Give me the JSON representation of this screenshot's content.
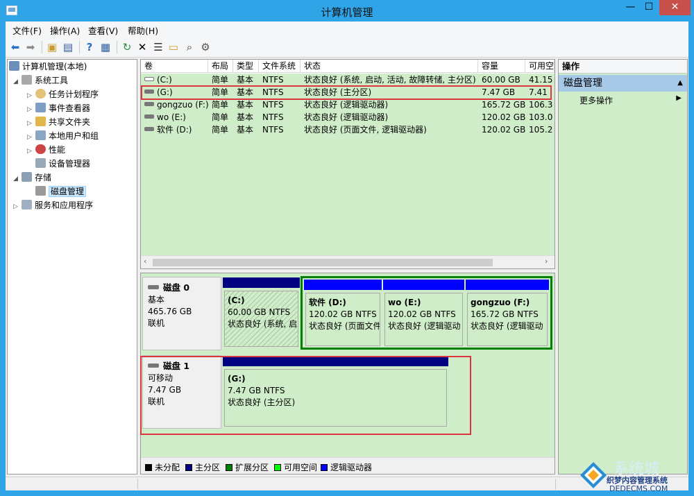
{
  "window": {
    "title": "计算机管理",
    "min_glyph": "—",
    "max_glyph": "☐",
    "close_glyph": "✕"
  },
  "menu": [
    {
      "label": "文件(F)"
    },
    {
      "label": "操作(A)"
    },
    {
      "label": "查看(V)"
    },
    {
      "label": "帮助(H)"
    }
  ],
  "toolbar": [
    "back-icon",
    "forward-icon",
    "up-folder-icon",
    "show-hide-tree-icon",
    "help-icon",
    "console-icon",
    "refresh-icon",
    "delete-icon",
    "properties-icon",
    "open-folder-icon",
    "search-icon",
    "settings-icon"
  ],
  "tree": [
    {
      "label": "计算机管理(本地)",
      "icon": "computer-icon",
      "arrow": ""
    },
    {
      "label": "系统工具",
      "icon": "tools-icon",
      "arrow": "◢"
    },
    {
      "label": "任务计划程序",
      "icon": "clock-icon",
      "arrow": "▷"
    },
    {
      "label": "事件查看器",
      "icon": "event-viewer-icon",
      "arrow": "▷"
    },
    {
      "label": "共享文件夹",
      "icon": "shared-folder-icon",
      "arrow": "▷"
    },
    {
      "label": "本地用户和组",
      "icon": "users-icon",
      "arrow": "▷"
    },
    {
      "label": "性能",
      "icon": "performance-icon",
      "arrow": "▷"
    },
    {
      "label": "设备管理器",
      "icon": "device-manager-icon",
      "arrow": ""
    },
    {
      "label": "存储",
      "icon": "storage-icon",
      "arrow": "◢"
    },
    {
      "label": "磁盘管理",
      "icon": "disk-management-icon",
      "arrow": ""
    },
    {
      "label": "服务和应用程序",
      "icon": "services-icon",
      "arrow": "▷"
    }
  ],
  "volumes": {
    "columns": [
      "卷",
      "布局",
      "类型",
      "文件系统",
      "状态",
      "容量",
      "可用空"
    ],
    "rows": [
      [
        "(C:)",
        "简单",
        "基本",
        "NTFS",
        "状态良好 (系统, 启动, 活动, 故障转储, 主分区)",
        "60.00 GB",
        "41.15"
      ],
      [
        "(G:)",
        "简单",
        "基本",
        "NTFS",
        "状态良好 (主分区)",
        "7.47 GB",
        "7.41"
      ],
      [
        "gongzuo (F:)",
        "简单",
        "基本",
        "NTFS",
        "状态良好 (逻辑驱动器)",
        "165.72 GB",
        "106.3"
      ],
      [
        "wo (E:)",
        "简单",
        "基本",
        "NTFS",
        "状态良好 (逻辑驱动器)",
        "120.02 GB",
        "103.0"
      ],
      [
        "软件 (D:)",
        "简单",
        "基本",
        "NTFS",
        "状态良好 (页面文件, 逻辑驱动器)",
        "120.02 GB",
        "105.2"
      ]
    ]
  },
  "disks": [
    {
      "name": "磁盘 0",
      "type": "基本",
      "size": "465.76 GB",
      "status": "联机",
      "partitions": [
        {
          "name": "(C:)",
          "size": "60.00 GB NTFS",
          "status": "状态良好 (系统, 启"
        },
        {
          "name": "软件  (D:)",
          "size": "120.02 GB NTFS",
          "status": "状态良好 (页面文件"
        },
        {
          "name": "wo  (E:)",
          "size": "120.02 GB NTFS",
          "status": "状态良好 (逻辑驱动"
        },
        {
          "name": "gongzuo  (F:)",
          "size": "165.72 GB NTFS",
          "status": "状态良好 (逻辑驱动"
        }
      ]
    },
    {
      "name": "磁盘 1",
      "type": "可移动",
      "size": "7.47 GB",
      "status": "联机",
      "partitions": [
        {
          "name": "(G:)",
          "size": "7.47 GB NTFS",
          "status": "状态良好 (主分区)"
        }
      ]
    }
  ],
  "legend": [
    {
      "label": "未分配",
      "color": "#000000"
    },
    {
      "label": "主分区",
      "color": "#000080"
    },
    {
      "label": "扩展分区",
      "color": "#008000"
    },
    {
      "label": "可用空间",
      "color": "#00ff00"
    },
    {
      "label": "逻辑驱动器",
      "color": "#0000ff"
    }
  ],
  "actions": {
    "header": "操作",
    "section": "磁盘管理",
    "item": "更多操作"
  },
  "watermark": {
    "line1": "系统城",
    "line2": "织梦内容管理系统",
    "line3": "DEDECMS.COM"
  },
  "colors": {
    "primary_partition": "#000080",
    "logical_drive": "#0000ff",
    "extended_partition": "#008000",
    "highlight": "#d9363e",
    "selected_bg": "#cfedc9"
  }
}
